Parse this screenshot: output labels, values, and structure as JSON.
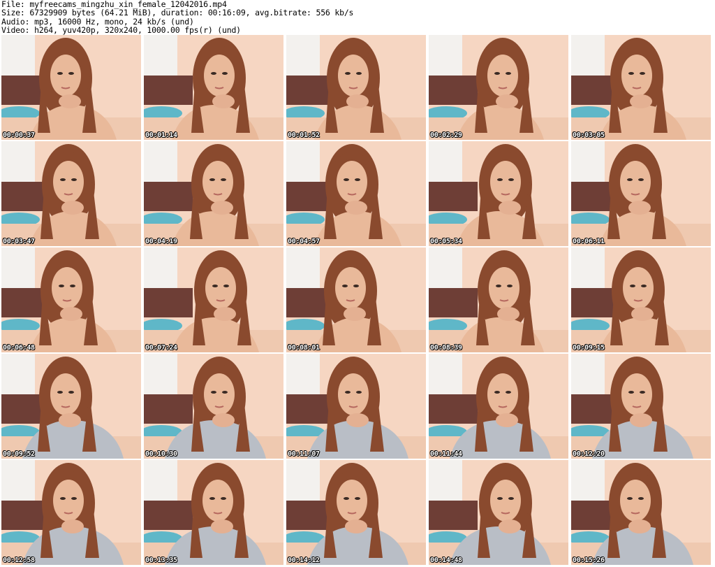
{
  "header": {
    "file_line": "File: myfreecams_mingzhu_xin_female_12042016.mp4",
    "size_line": "Size: 67329909 bytes (64.21 MiB), duration: 00:16:09, avg.bitrate: 556 kb/s",
    "audio_line": "Audio: mp3, 16000 Hz, mono, 24 kb/s (und)",
    "video_line": "Video: h264, yuv420p, 320x240, 1000.00 fps(r) (und)"
  },
  "thumbnails": [
    {
      "timestamp": "00:00:37",
      "top": "skin"
    },
    {
      "timestamp": "00:01:14",
      "top": "skin"
    },
    {
      "timestamp": "00:01:52",
      "top": "skin"
    },
    {
      "timestamp": "00:02:29",
      "top": "skin"
    },
    {
      "timestamp": "00:03:05",
      "top": "skin"
    },
    {
      "timestamp": "00:03:47",
      "top": "skin"
    },
    {
      "timestamp": "00:04:19",
      "top": "skin"
    },
    {
      "timestamp": "00:04:57",
      "top": "skin"
    },
    {
      "timestamp": "00:05:34",
      "top": "skin"
    },
    {
      "timestamp": "00:06:11",
      "top": "skin"
    },
    {
      "timestamp": "00:06:48",
      "top": "skin"
    },
    {
      "timestamp": "00:07:24",
      "top": "skin"
    },
    {
      "timestamp": "00:08:01",
      "top": "skin"
    },
    {
      "timestamp": "00:08:39",
      "top": "skin"
    },
    {
      "timestamp": "00:09:15",
      "top": "skin"
    },
    {
      "timestamp": "00:09:52",
      "top": "sweater"
    },
    {
      "timestamp": "00:10:30",
      "top": "sweater"
    },
    {
      "timestamp": "00:11:07",
      "top": "sweater"
    },
    {
      "timestamp": "00:11:44",
      "top": "sweater"
    },
    {
      "timestamp": "00:12:20",
      "top": "sweater"
    },
    {
      "timestamp": "00:12:58",
      "top": "sweater"
    },
    {
      "timestamp": "00:13:35",
      "top": "sweater"
    },
    {
      "timestamp": "00:14:12",
      "top": "sweater"
    },
    {
      "timestamp": "00:14:48",
      "top": "sweater"
    },
    {
      "timestamp": "00:15:26",
      "top": "sweater"
    }
  ],
  "colors": {
    "wall": "#f6d6c2",
    "window": "#f3f1ee",
    "headboard": "#6e3e36",
    "pillow": "#5fb7c8",
    "hair": "#8a4a2e",
    "skin": "#e9b99a",
    "sweater": "#b9bec6"
  }
}
